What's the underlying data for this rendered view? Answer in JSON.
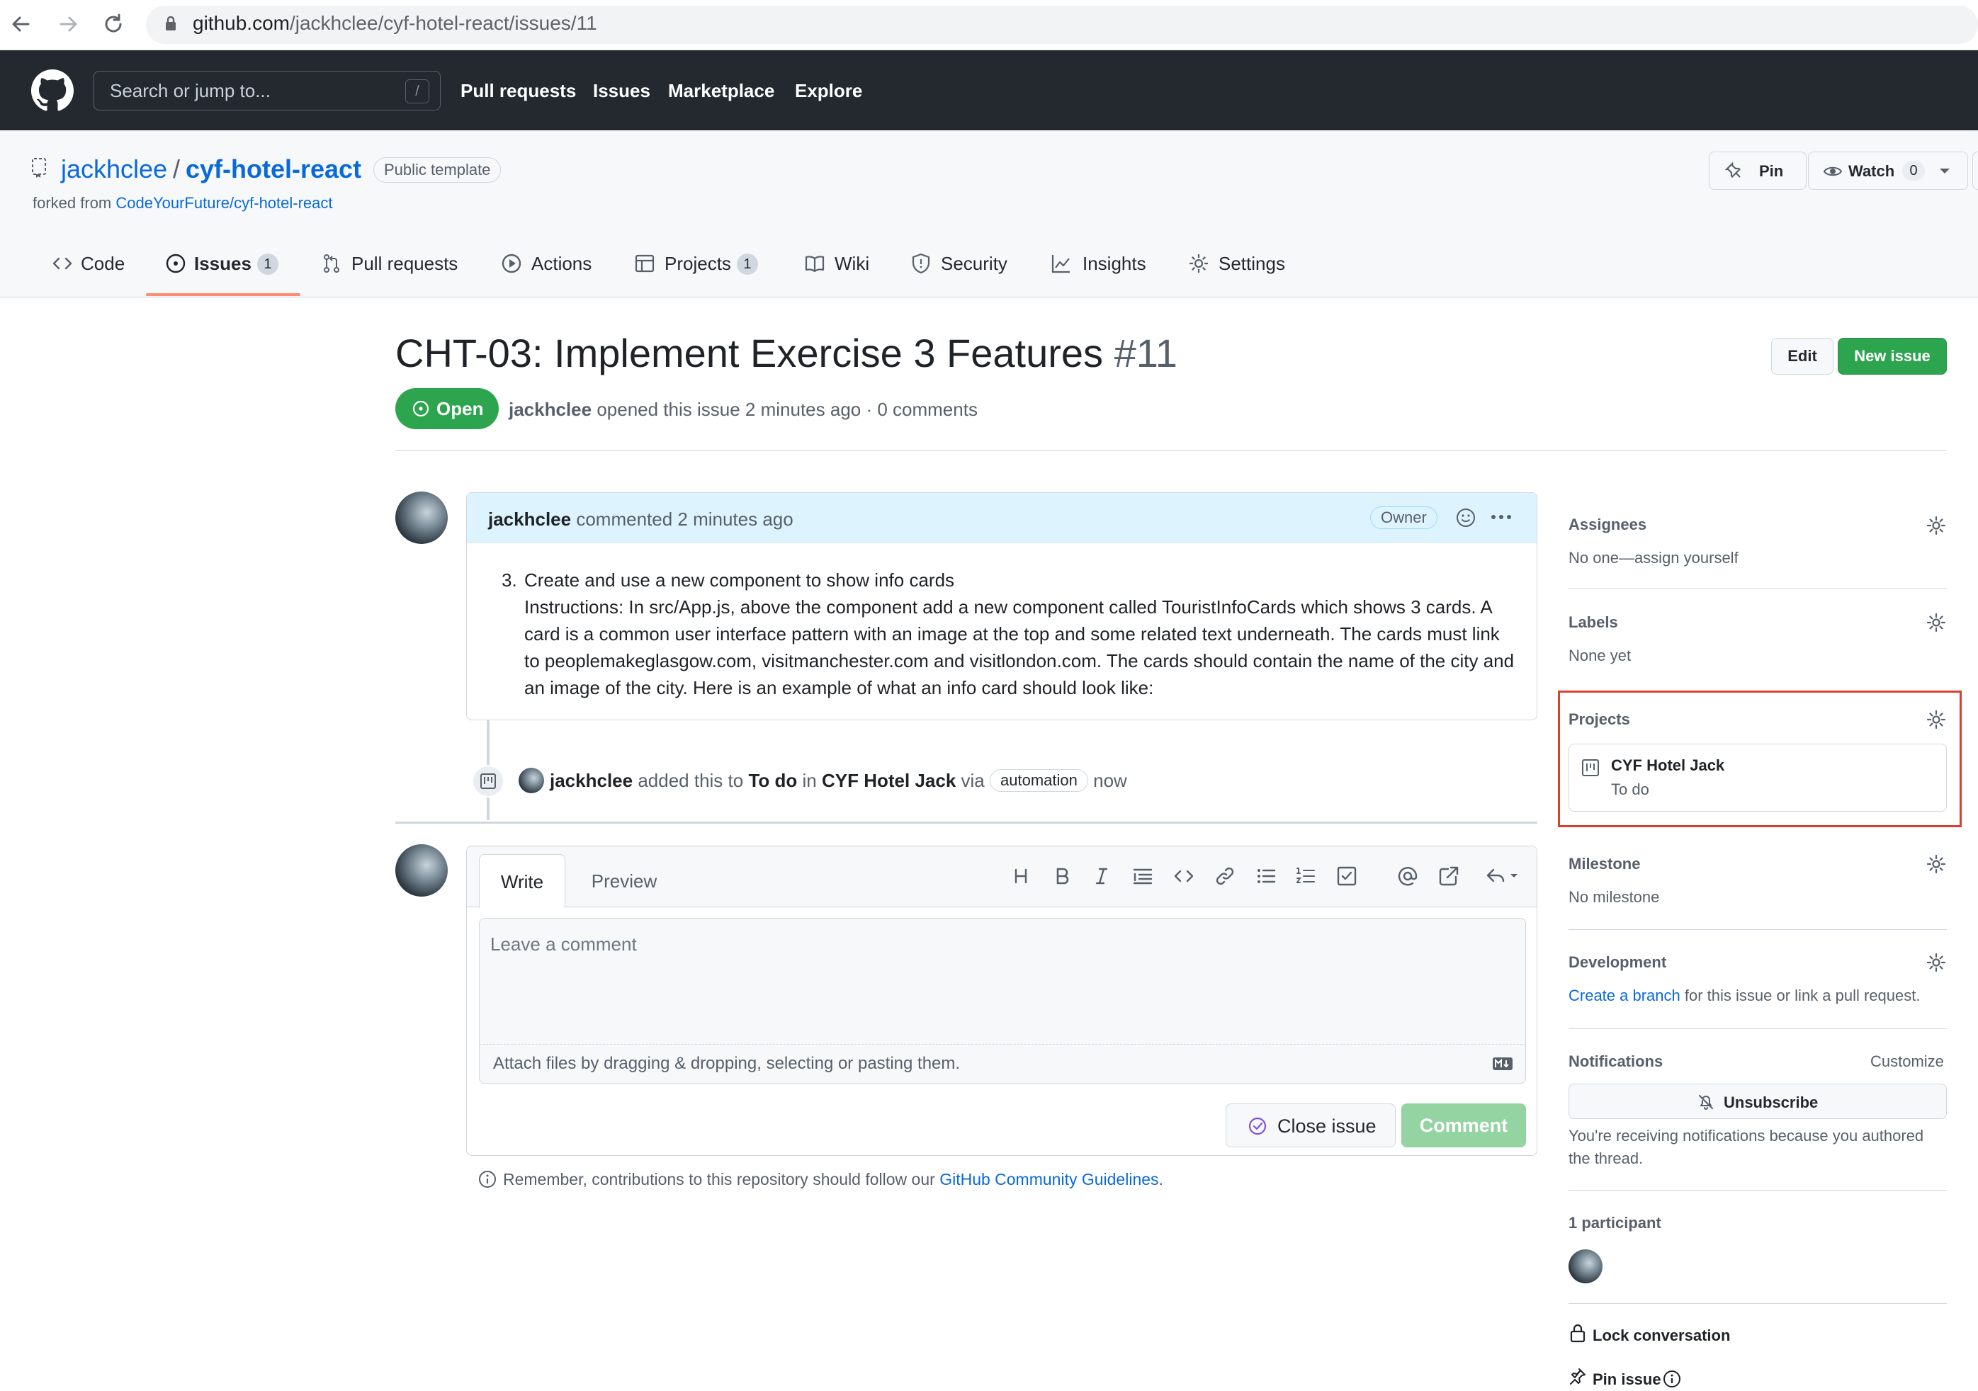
{
  "browser": {
    "url_host": "github.com",
    "url_path": "/jackhclee/cyf-hotel-react/issues/11",
    "back_icon": "arrow-left-icon",
    "forward_icon": "arrow-right-icon",
    "reload_icon": "reload-icon"
  },
  "header": {
    "search_placeholder": "Search or jump to...",
    "search_key": "/",
    "nav": [
      "Pull requests",
      "Issues",
      "Marketplace",
      "Explore"
    ]
  },
  "repo": {
    "owner": "jackhclee",
    "separator": "/",
    "name": "cyf-hotel-react",
    "visibility": "Public template",
    "forked_prefix": "forked from",
    "forked_from": "CodeYourFuture/cyf-hotel-react",
    "pin_label": "Pin",
    "watch_label": "Watch",
    "watch_count": "0"
  },
  "tabs": [
    {
      "label": "Code",
      "count": null,
      "icon": "code-icon"
    },
    {
      "label": "Issues",
      "count": "1",
      "icon": "issue-opened-icon",
      "selected": true
    },
    {
      "label": "Pull requests",
      "count": null,
      "icon": "git-pull-request-icon"
    },
    {
      "label": "Actions",
      "count": null,
      "icon": "play-icon"
    },
    {
      "label": "Projects",
      "count": "1",
      "icon": "table-icon"
    },
    {
      "label": "Wiki",
      "count": null,
      "icon": "book-icon"
    },
    {
      "label": "Security",
      "count": null,
      "icon": "shield-icon"
    },
    {
      "label": "Insights",
      "count": null,
      "icon": "graph-icon"
    },
    {
      "label": "Settings",
      "count": null,
      "icon": "gear-icon"
    }
  ],
  "issue": {
    "title": "CHT-03: Implement Exercise 3 Features",
    "number": "#11",
    "edit_label": "Edit",
    "new_issue_label": "New issue",
    "state": "Open",
    "author": "jackhclee",
    "opened_text": "opened this issue 2 minutes ago · 0 comments"
  },
  "comment": {
    "author": "jackhclee",
    "action": "commented 2 minutes ago",
    "badge": "Owner",
    "list_number": "3.",
    "line1": "Create and use a new component to show info cards",
    "body": "Instructions: In src/App.js, above the component add a new component called TouristInfoCards which shows 3 cards. A card is a common user interface pattern with an image at the top and some related text underneath. The cards must link to peoplemakeglasgow.com, visitmanchester.com and visitlondon.com. The cards should contain the name of the city and an image of the city. Here is an example of what an info card should look like:"
  },
  "timeline": {
    "author": "jackhclee",
    "text1": "added this to",
    "column": "To do",
    "text2": "in",
    "project": "CYF Hotel Jack",
    "text3": "via",
    "via_badge": "automation",
    "time": "now"
  },
  "new_comment": {
    "tab_write": "Write",
    "tab_preview": "Preview",
    "placeholder": "Leave a comment",
    "attach_text": "Attach files by dragging & dropping, selecting or pasting them.",
    "close_issue_label": "Close issue",
    "comment_label": "Comment",
    "toolbar": [
      "heading-icon",
      "bold-icon",
      "italic-icon",
      "quote-icon",
      "code-icon",
      "link-icon",
      "unordered-list-icon",
      "ordered-list-icon",
      "tasklist-icon",
      "mention-icon",
      "cross-reference-icon",
      "reply-icon"
    ],
    "reminder_prefix": "Remember, contributions to this repository should follow our",
    "reminder_link": "GitHub Community Guidelines",
    "reminder_suffix": "."
  },
  "sidebar": {
    "assignees_label": "Assignees",
    "assignees_value": "No one—assign yourself",
    "labels_label": "Labels",
    "labels_value": "None yet",
    "projects_label": "Projects",
    "project_name": "CYF Hotel Jack",
    "project_column": "To do",
    "milestone_label": "Milestone",
    "milestone_value": "No milestone",
    "development_label": "Development",
    "development_link": "Create a branch",
    "development_rest": "for this issue or link a pull request.",
    "notifications_label": "Notifications",
    "customize_label": "Customize",
    "unsubscribe_label": "Unsubscribe",
    "notifications_text": "You're receiving notifications because you authored the thread.",
    "participants_label": "1 participant",
    "lock_label": "Lock conversation",
    "pin_label": "Pin issue"
  },
  "colors": {
    "accent_link": "#0969da",
    "open_green": "#2da44e",
    "header_dark": "#24292f",
    "highlight_red": "#d93f2d",
    "tab_underline": "#fd8c73"
  }
}
